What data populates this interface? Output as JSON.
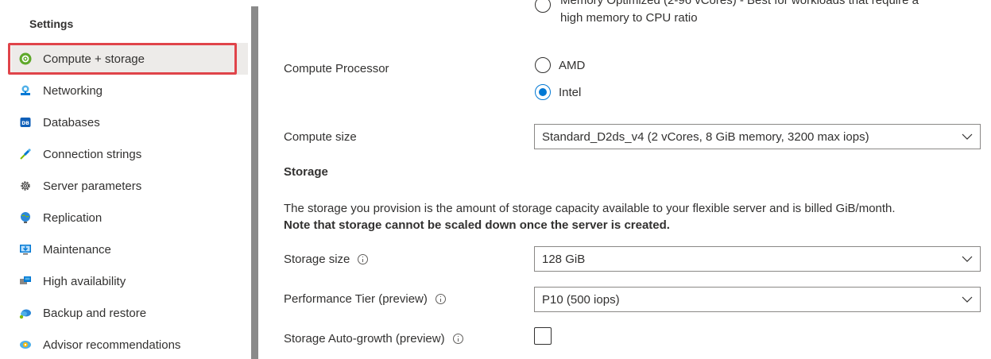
{
  "sidebar": {
    "title": "Settings",
    "items": [
      {
        "label": "Compute + storage",
        "icon": "compute-storage-icon"
      },
      {
        "label": "Networking",
        "icon": "networking-icon"
      },
      {
        "label": "Databases",
        "icon": "databases-icon"
      },
      {
        "label": "Connection strings",
        "icon": "connection-strings-icon"
      },
      {
        "label": "Server parameters",
        "icon": "gear-icon"
      },
      {
        "label": "Replication",
        "icon": "replication-icon"
      },
      {
        "label": "Maintenance",
        "icon": "maintenance-icon"
      },
      {
        "label": "High availability",
        "icon": "high-availability-icon"
      },
      {
        "label": "Backup and restore",
        "icon": "backup-restore-icon"
      },
      {
        "label": "Advisor recommendations",
        "icon": "advisor-icon"
      }
    ]
  },
  "compute": {
    "memory_option_line1": "Memory Optimized (2-96 vCores) - Best for workloads that require a",
    "memory_option_line2": "high memory to CPU ratio",
    "processor_label": "Compute Processor",
    "processor_options": [
      "AMD",
      "Intel"
    ],
    "processor_selected": "Intel",
    "size_label": "Compute size",
    "size_value": "Standard_D2ds_v4 (2 vCores, 8 GiB memory, 3200 max iops)"
  },
  "storage": {
    "section_title": "Storage",
    "description": "The storage you provision is the amount of storage capacity available to your flexible server and is billed GiB/month.",
    "description_bold": "Note that storage cannot be scaled down once the server is created.",
    "size_label": "Storage size",
    "size_value": "128 GiB",
    "tier_label": "Performance Tier (preview)",
    "tier_value": "P10 (500 iops)",
    "autogrowth_label": "Storage Auto-growth (preview)"
  },
  "colors": {
    "accent": "#0078d4",
    "highlight": "#e0444a",
    "selected_bg": "#edebe9",
    "text": "#323130"
  }
}
